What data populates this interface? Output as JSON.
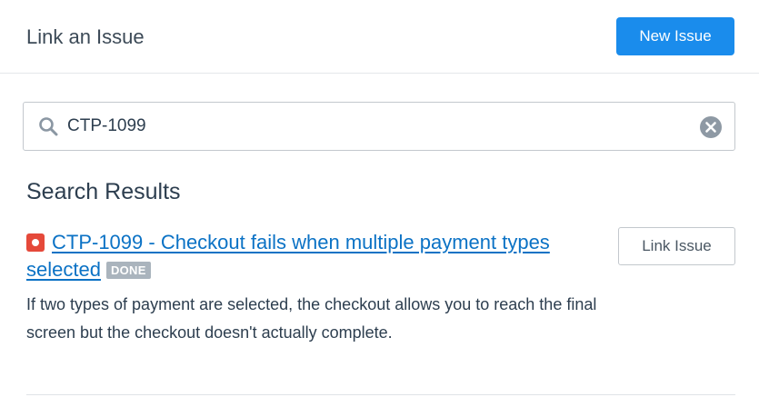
{
  "header": {
    "title": "Link an Issue",
    "new_issue_label": "New Issue"
  },
  "search": {
    "value": "CTP-1099",
    "icon": "search-icon",
    "clear_icon": "clear-icon"
  },
  "results": {
    "heading": "Search Results",
    "items": [
      {
        "key_and_title": "CTP-1099 - Checkout fails when multiple payment types selected",
        "status": "DONE",
        "description": "If two types of payment are selected, the checkout allows you to reach the final screen but the checkout doesn't actually complete.",
        "action_label": "Link Issue",
        "priority_icon": "priority-icon"
      }
    ]
  },
  "colors": {
    "primary": "#1a8cec",
    "link": "#0b72c5",
    "priority": "#e5493a",
    "badge": "#aab4bd"
  }
}
